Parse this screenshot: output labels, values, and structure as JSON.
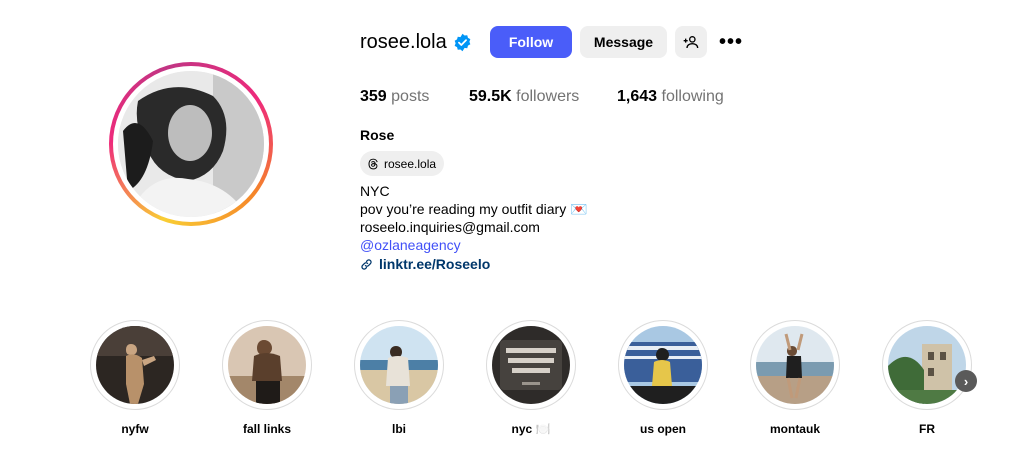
{
  "profile": {
    "username": "rosee.lola",
    "full_name": "Rose",
    "threads_handle": "rosee.lola",
    "verified": true
  },
  "actions": {
    "follow_label": "Follow",
    "message_label": "Message",
    "more_label": "•••"
  },
  "stats": {
    "posts_count": "359",
    "posts_label": "posts",
    "followers_count": "59.5K",
    "followers_label": "followers",
    "following_count": "1,643",
    "following_label": "following"
  },
  "bio": {
    "line1": "NYC",
    "line2": "pov you’re reading my outfit diary 💌",
    "line3": "roseelo.inquiries@gmail.com",
    "mention": "@ozlaneagency",
    "link": "linktr.ee/Roseelo"
  },
  "highlights": [
    {
      "label": "nyfw"
    },
    {
      "label": "fall links"
    },
    {
      "label": "lbi"
    },
    {
      "label": "nyc 🍽️"
    },
    {
      "label": "us open"
    },
    {
      "label": "montauk"
    },
    {
      "label": "FR"
    }
  ],
  "icons": {
    "verified": "verified-badge-icon",
    "add_user": "add-user-icon",
    "more": "more-options-icon",
    "threads": "threads-icon",
    "link": "link-icon",
    "next": "chevron-right-icon"
  },
  "colors": {
    "follow_button": "#4a5df9",
    "secondary_button": "#efefef",
    "verified": "#0095f6",
    "mention": "#4150f7",
    "link": "#00376b",
    "muted_text": "#737373"
  }
}
